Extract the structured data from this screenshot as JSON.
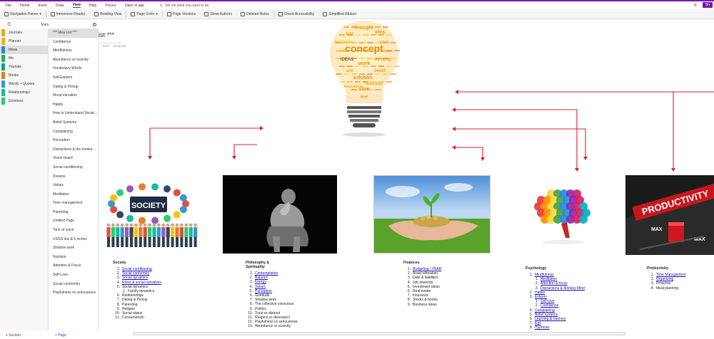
{
  "ribbon": {
    "menu": [
      "File",
      "Home",
      "Insert",
      "Draw",
      "View",
      "Help",
      "Picture",
      "Open in app"
    ],
    "active_menu": "View",
    "tell_me": "Tell me what you want to do",
    "share": "Sh",
    "tools": [
      {
        "label": "Navigation Panes",
        "icon": "navigation-panes-icon",
        "dropdown": true
      },
      {
        "label": "Immersive Reader",
        "icon": "immersive-reader-icon"
      },
      {
        "label": "Reading View",
        "icon": "reading-view-icon"
      },
      {
        "label": "Page Color",
        "icon": "page-color-icon",
        "dropdown": true
      },
      {
        "label": "Page Versions",
        "icon": "page-versions-icon"
      },
      {
        "label": "Show Authors",
        "icon": "show-authors-icon"
      },
      {
        "label": "Deleted Notes",
        "icon": "deleted-notes-icon"
      },
      {
        "label": "Check Accessibility",
        "icon": "check-accessibility-icon"
      },
      {
        "label": "Simplified Ribbon",
        "icon": "toggle-checkbox-icon"
      }
    ]
  },
  "nav": {
    "search_crumb": "Main",
    "sections": [
      {
        "label": "Journals",
        "color": "#f5a623"
      },
      {
        "label": "Planner",
        "color": "#f0b400"
      },
      {
        "label": "Ideas",
        "color": "#2e86de",
        "active": true
      },
      {
        "label": "Me",
        "color": "#27ae60"
      },
      {
        "label": "Youtube",
        "color": "#16a085"
      },
      {
        "label": "Books",
        "color": "#e67e22"
      },
      {
        "label": "Words + Quotes",
        "color": "#3498db"
      },
      {
        "label": "Relationships",
        "color": "#1abc9c"
      },
      {
        "label": "Emotions",
        "color": "#2ecc71"
      }
    ],
    "pages": [
      {
        "label": "*** Idea List ***",
        "active": true
      },
      {
        "label": "Confidence"
      },
      {
        "label": "Mindfulness"
      },
      {
        "label": "Abundance vs scarcity"
      },
      {
        "label": "Vocabulary Words"
      },
      {
        "label": "Self-Esteem"
      },
      {
        "label": "Dating & Pickup"
      },
      {
        "label": "Mood elevation"
      },
      {
        "label": "Habits"
      },
      {
        "label": "How to Understand Social Cues"
      },
      {
        "label": "Belief Systems"
      },
      {
        "label": "Complaining"
      },
      {
        "label": "Perception"
      },
      {
        "label": "Distractions & the monkey mind"
      },
      {
        "label": "Vision board"
      },
      {
        "label": "Social conditioning"
      },
      {
        "label": "Dreams"
      },
      {
        "label": "Values"
      },
      {
        "label": "Meditation"
      },
      {
        "label": "Time management"
      },
      {
        "label": "Parenting"
      },
      {
        "label": "Untitled Page"
      },
      {
        "label": "Tone of voice"
      },
      {
        "label": "USGS low & 6 inches"
      },
      {
        "label": "Shadow work"
      },
      {
        "label": "Nutrition"
      },
      {
        "label": "Attention & Focus"
      },
      {
        "label": "Self-Love"
      },
      {
        "label": "Social conformity"
      },
      {
        "label": "Playfulness vs seriousness"
      }
    ],
    "add_section": "+ Section",
    "add_page": "+ Page"
  },
  "page": {
    "title": "*** Idea List ***",
    "date": "2020",
    "time": "10:30 PM",
    "bulb_words": [
      "thought",
      "hint",
      "idea",
      "business",
      "plan",
      "concept",
      "IDEAS",
      "thinking",
      "work",
      "aim",
      "belief",
      "solution",
      "success",
      "clue",
      "innovation",
      "goal",
      "creative",
      "vision"
    ]
  },
  "columns": [
    {
      "key": "society",
      "title": "Society",
      "items": [
        {
          "n": "1.",
          "text": "Social conditioning",
          "link": true
        },
        {
          "n": "2.",
          "text": "Social conformity",
          "link": true
        },
        {
          "n": "3.",
          "text": "Social dynamics",
          "link": true
        },
        {
          "n": "4.",
          "text": "Roles & social narratives",
          "link": true
        },
        {
          "n": "5.",
          "text": "Social dynamics"
        },
        {
          "n": "1.",
          "text": "Family dynamics",
          "sub": true
        },
        {
          "n": "6.",
          "text": "Relationships"
        },
        {
          "n": "7.",
          "text": "Dating & Pickup"
        },
        {
          "n": "8.",
          "text": "Parenting"
        },
        {
          "n": "9.",
          "text": "Religion"
        },
        {
          "n": "10.",
          "text": "Social status"
        },
        {
          "n": "11.",
          "text": "Consumerism"
        }
      ]
    },
    {
      "key": "philosophy",
      "title": "Philosophy & Spirituality",
      "items": [
        {
          "n": "1.",
          "text": "Contemplation",
          "link": true
        },
        {
          "n": "2.",
          "text": "Balance",
          "link": true
        },
        {
          "n": "3.",
          "text": "Energy",
          "link": true
        },
        {
          "n": "4.",
          "text": "Values",
          "link": true
        },
        {
          "n": "5.",
          "text": "Perception",
          "link": true
        },
        {
          "n": "6.",
          "text": "Gratitude"
        },
        {
          "n": "7.",
          "text": "Shadow work"
        },
        {
          "n": "8.",
          "text": "The collective conscious"
        },
        {
          "n": "9.",
          "text": "Politics"
        },
        {
          "n": "10.",
          "text": "Trust vs distrust"
        },
        {
          "n": "11.",
          "text": "Respect vs disrespect"
        },
        {
          "n": "12.",
          "text": "Playfulness vs seriousness"
        },
        {
          "n": "13.",
          "text": "Abundance vs scarcity"
        }
      ]
    },
    {
      "key": "finances",
      "title": "Finances",
      "items": [
        {
          "n": "1.",
          "text": "Budgeting / YNAB",
          "link": true
        },
        {
          "n": "2.",
          "text": "Asset allocation"
        },
        {
          "n": "3.",
          "text": "Debt & liabilities"
        },
        {
          "n": "4.",
          "text": "Job interests"
        },
        {
          "n": "5.",
          "text": "Investment ideas"
        },
        {
          "n": "6.",
          "text": "Real estate"
        },
        {
          "n": "7.",
          "text": "Insurance"
        },
        {
          "n": "8.",
          "text": "Stocks & bonds"
        },
        {
          "n": "9.",
          "text": "Business ideas"
        }
      ]
    },
    {
      "key": "psychology",
      "title": "Psychology",
      "items": [
        {
          "n": "1.",
          "text": "Mindfulness",
          "link": true
        },
        {
          "n": "1.",
          "text": "Meditation",
          "link": true,
          "sub": true
        },
        {
          "n": "2.",
          "text": "Attention & focus",
          "link": true,
          "sub": true
        },
        {
          "n": "3.",
          "text": "Distractions & Monkey Mind",
          "link": true,
          "sub": true
        },
        {
          "n": "2.",
          "text": "Habits",
          "link": true
        },
        {
          "n": "3.",
          "text": "Esteem",
          "link": true
        },
        {
          "n": "1.",
          "text": "Self-love",
          "link": true,
          "sub": true
        },
        {
          "n": "2.",
          "text": "Confidence",
          "link": true,
          "sub": true
        },
        {
          "n": "4.",
          "text": "Complaining",
          "link": true
        },
        {
          "n": "5.",
          "text": "Belief systems",
          "link": true
        },
        {
          "n": "6.",
          "text": "Learning & memory",
          "link": true
        },
        {
          "n": "7.",
          "text": "Ego",
          "link": true
        },
        {
          "n": "8.",
          "text": "Hypnosis",
          "link": true
        }
      ]
    },
    {
      "key": "productivity",
      "title": "Productivity",
      "items": [
        {
          "n": "1.",
          "text": "Time Management",
          "link": true
        },
        {
          "n": "2.",
          "text": "Organizing",
          "link": true
        },
        {
          "n": "3.",
          "text": "Proactive"
        },
        {
          "n": "4.",
          "text": "Meal planning"
        }
      ]
    }
  ],
  "images": {
    "society_label": "SOCIETY",
    "productivity_label": "PRODUCTIVITY",
    "max_label": "MAX"
  },
  "colors": {
    "accent": "#7719aa",
    "arrow": "#e0202a",
    "link": "#1a0dab"
  }
}
